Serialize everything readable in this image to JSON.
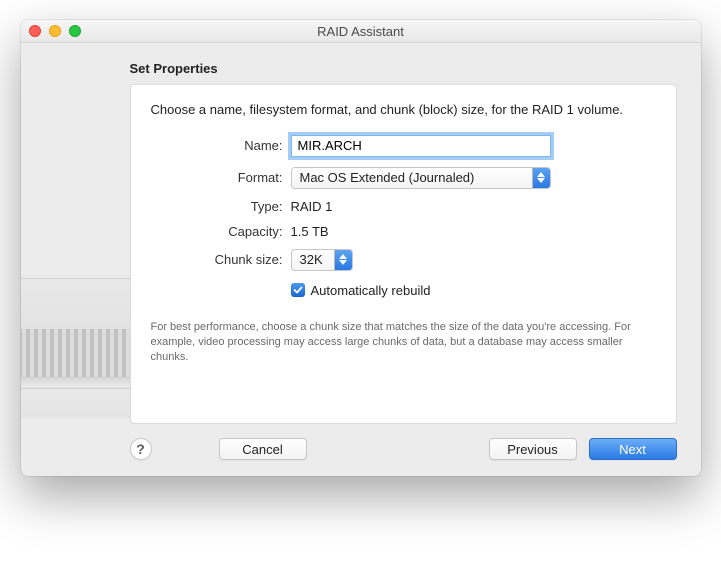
{
  "window": {
    "title": "RAID Assistant"
  },
  "section_title": "Set Properties",
  "intro": "Choose a name, filesystem format, and chunk (block) size, for the RAID 1 volume.",
  "labels": {
    "name": "Name:",
    "format": "Format:",
    "type": "Type:",
    "capacity": "Capacity:",
    "chunk": "Chunk size:"
  },
  "values": {
    "name": "MIR.ARCH",
    "format_selected": "Mac OS Extended (Journaled)",
    "type": "RAID 1",
    "capacity": "1.5 TB",
    "chunk_selected": "32K"
  },
  "checkbox": {
    "label": "Automatically rebuild",
    "checked": true
  },
  "footnote": "For best performance, choose a chunk size that matches the size of the data you're accessing. For example, video processing may access large chunks of data, but a database may access smaller chunks.",
  "buttons": {
    "help": "?",
    "cancel": "Cancel",
    "previous": "Previous",
    "next": "Next"
  }
}
